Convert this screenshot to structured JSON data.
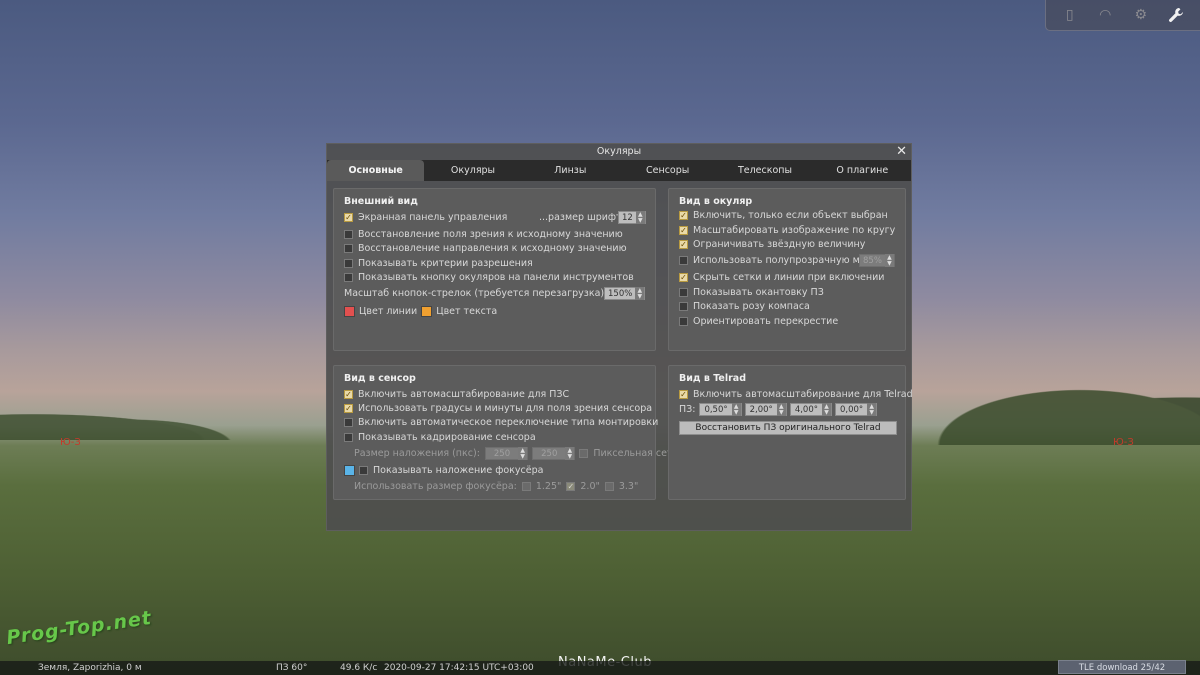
{
  "sky": {
    "cardinal_left": "Ю-З",
    "cardinal_right": "Ю-З"
  },
  "topbar": {
    "icons": [
      "window-icon",
      "circle-icon",
      "gear-icon",
      "wrench-icon"
    ]
  },
  "dialog": {
    "title": "Окуляры",
    "close_label": "✕",
    "tabs": [
      "Основные",
      "Окуляры",
      "Линзы",
      "Сенсоры",
      "Телескопы",
      "О плагине"
    ],
    "active_tab": "Основные",
    "appearance": {
      "heading": "Внешний вид",
      "items": [
        {
          "label": "Экранная панель управления",
          "checked": true
        },
        {
          "label": "Восстановление поля зрения к исходному значению",
          "checked": false
        },
        {
          "label": "Восстановление направления к исходному значению",
          "checked": false
        },
        {
          "label": "Показывать критерии разрешения",
          "checked": false
        },
        {
          "label": "Показывать кнопку окуляров на панели инструментов",
          "checked": false
        }
      ],
      "font_size_label": "...размер шрифта",
      "font_size_value": "12",
      "arrow_scale_label": "Масштаб кнопок-стрелок (требуется перезагрузка)",
      "arrow_scale_value": "150%",
      "line_color_label": "Цвет линии",
      "line_color": "#e2504f",
      "text_color_label": "Цвет текста",
      "text_color": "#f0a030"
    },
    "eyepiece_view": {
      "heading": "Вид в окуляр",
      "items": [
        {
          "label": "Включить, только если объект выбран",
          "checked": true
        },
        {
          "label": "Масштабировать изображение по кругу",
          "checked": true
        },
        {
          "label": "Ограничивать звёздную величину",
          "checked": true
        },
        {
          "label": "Использовать полупрозрачную маску",
          "checked": false
        },
        {
          "label": "Скрыть сетки и линии при включении",
          "checked": true
        },
        {
          "label": "Показывать окантовку ПЗ",
          "checked": false
        },
        {
          "label": "Показать розу компаса",
          "checked": false
        },
        {
          "label": "Ориентировать перекрестие",
          "checked": false
        }
      ],
      "mask_value": "85%"
    },
    "sensor_view": {
      "heading": "Вид в сенсор",
      "items": [
        {
          "label": "Включить автомасштабирование для ПЗС",
          "checked": true
        },
        {
          "label": "Использовать градусы и минуты для поля зрения сенсора",
          "checked": true
        },
        {
          "label": "Включить автоматическое переключение типа монтировки",
          "checked": false
        },
        {
          "label": "Показывать кадрирование сенсора",
          "checked": false
        }
      ],
      "overlay_size_label": "Размер наложения (пкс):",
      "overlay_w": "250",
      "overlay_h": "250",
      "pixel_grid_label": "Пиксельная сетка",
      "focuser_overlay_label": "Показывать наложение фокусёра",
      "focuser_color": "#5ab4e8",
      "focuser_size_label": "Использовать размер фокусёра:",
      "focuser_sizes": [
        {
          "label": "1.25\"",
          "checked": false
        },
        {
          "label": "2.0\"",
          "checked": true
        },
        {
          "label": "3.3\"",
          "checked": false
        }
      ]
    },
    "telrad_view": {
      "heading": "Вид в Telrad",
      "autoscale_label": "Включить автомасштабирование для Telrad",
      "autoscale_checked": true,
      "fov_label": "ПЗ:",
      "fov_values": [
        "0,50°",
        "2,00°",
        "4,00°",
        "0,00°"
      ],
      "reset_button": "Восстановить ПЗ оригинального Telrad"
    }
  },
  "status": {
    "location": "Земля, Zaporizhia, 0 м",
    "fov": "ПЗ 60°",
    "fps": "49.6 К/с",
    "datetime": "2020-09-27 17:42:15 UTC+03:00",
    "tle": "TLE download 25/42"
  },
  "watermarks": {
    "left": "Prog-Top.net",
    "center": "NaNaMe-Club"
  }
}
